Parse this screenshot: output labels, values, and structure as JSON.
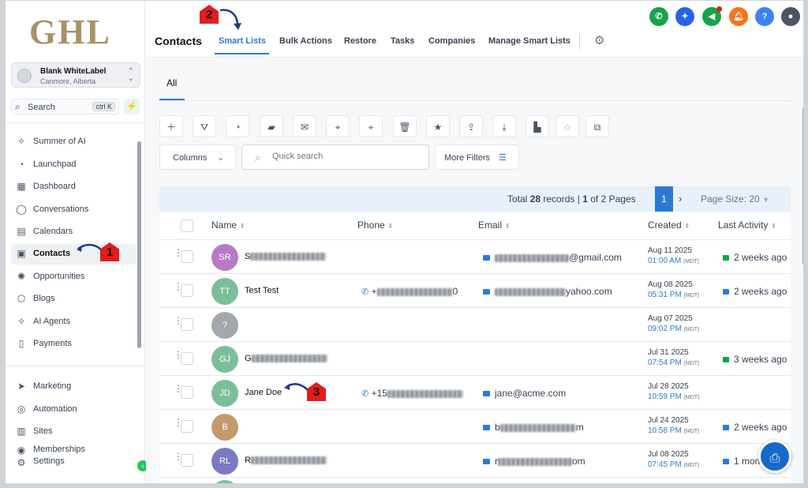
{
  "logo": "GHL",
  "account": {
    "name": "Blank WhiteLabel",
    "location": "Canmore, Alberta"
  },
  "search": {
    "label": "Search",
    "shortcut": "ctrl K"
  },
  "nav": {
    "main": [
      {
        "label": "Summer of AI",
        "icon": "sparkle-icon"
      },
      {
        "label": "Launchpad",
        "icon": "rocket-icon"
      },
      {
        "label": "Dashboard",
        "icon": "grid-icon"
      },
      {
        "label": "Conversations",
        "icon": "chat-icon"
      },
      {
        "label": "Calendars",
        "icon": "calendar-icon"
      },
      {
        "label": "Contacts",
        "icon": "contacts-icon",
        "active": true
      },
      {
        "label": "Opportunities",
        "icon": "opportunities-icon"
      },
      {
        "label": "Blogs",
        "icon": "blog-icon"
      },
      {
        "label": "AI Agents",
        "icon": "sparkle-icon"
      },
      {
        "label": "Payments",
        "icon": "payments-icon"
      }
    ],
    "secondary": [
      {
        "label": "Marketing",
        "icon": "send-icon"
      },
      {
        "label": "Automation",
        "icon": "automation-icon"
      },
      {
        "label": "Sites",
        "icon": "sites-icon"
      },
      {
        "label": "Memberships",
        "icon": "memberships-icon"
      },
      {
        "label": "Settings",
        "icon": "gear-icon"
      }
    ]
  },
  "header": {
    "title": "Contacts",
    "tabs": [
      "Smart Lists",
      "Bulk Actions",
      "Restore",
      "Tasks",
      "Companies",
      "Manage Smart Lists"
    ],
    "active_tab": "Smart Lists"
  },
  "list_tab": "All",
  "toolbar": {
    "columns_label": "Columns",
    "search_placeholder": "Quick search",
    "more_filters_label": "More Filters"
  },
  "pagination": {
    "total_records": "28",
    "page": "1",
    "pages": "2",
    "page_size": "20"
  },
  "table": {
    "columns": [
      "Name",
      "Phone",
      "Email",
      "Created",
      "Last Activity"
    ],
    "rows": [
      {
        "initials": "SR",
        "color": "#b67bc4",
        "name_prefix": "S",
        "phone": "",
        "email_suffix": "@gmail.com",
        "created_date": "Aug 11 2025",
        "created_time": "01:00 AM",
        "tz": "(MDT)",
        "activity": "2 weeks ago",
        "activity_type": "sms"
      },
      {
        "initials": "TT",
        "color": "#7bbf9a",
        "name": "Test Test",
        "phone_prefix": "+",
        "phone_suffix": "0",
        "email_suffix": "yahoo.com",
        "created_date": "Aug 08 2025",
        "created_time": "05:31 PM",
        "tz": "(MDT)",
        "activity": "2 weeks ago",
        "activity_type": "email"
      },
      {
        "initials": "?",
        "color": "#a3a8ae",
        "name": "",
        "phone": "",
        "email": "",
        "created_date": "Aug 07 2025",
        "created_time": "09:02 PM",
        "tz": "(MDT)",
        "activity": "",
        "activity_type": ""
      },
      {
        "initials": "GJ",
        "color": "#7bbf9a",
        "name_prefix": "G",
        "phone": "",
        "email": "",
        "created_date": "Jul 31 2025",
        "created_time": "07:54 PM",
        "tz": "(MDT)",
        "activity": "3 weeks ago",
        "activity_type": "sms"
      },
      {
        "initials": "JD",
        "color": "#7bbf9a",
        "name": "Jane Doe",
        "phone_prefix": "+15",
        "email": "jane@acme.com",
        "created_date": "Jul 28 2025",
        "created_time": "10:59 PM",
        "tz": "(MDT)",
        "activity": "",
        "activity_type": ""
      },
      {
        "initials": "B",
        "color": "#c49a6c",
        "name": "",
        "phone": "",
        "email_prefix": "b",
        "email_suffix": "m",
        "created_date": "Jul 24 2025",
        "created_time": "10:58 PM",
        "tz": "(MDT)",
        "activity": "2 weeks ago",
        "activity_type": "email"
      },
      {
        "initials": "RL",
        "color": "#7b79c4",
        "name_prefix": "R",
        "phone": "",
        "email_prefix": "r",
        "email_suffix": "om",
        "created_date": "Jul 08 2025",
        "created_time": "07:45 PM",
        "tz": "(MDT)",
        "activity": "1 mon",
        "activity_type": "email"
      }
    ]
  },
  "annotations": [
    "1",
    "2",
    "3"
  ],
  "colors": {
    "accent": "#2b7bd1",
    "annotation": "#e11d1d",
    "logo": "#a89168"
  }
}
